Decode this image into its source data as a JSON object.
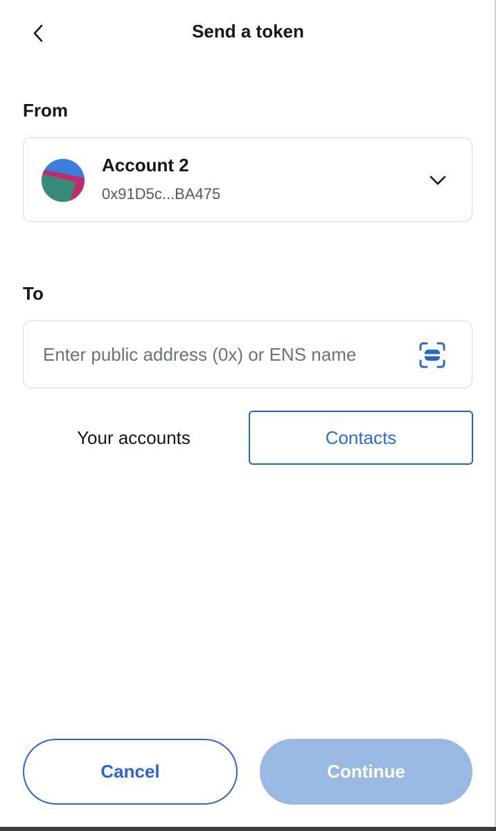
{
  "header": {
    "title": "Send a token",
    "back_icon": "chevron-left-icon"
  },
  "from": {
    "label": "From",
    "account_name": "Account 2",
    "account_address": "0x91D5c...BA475",
    "avatar_colors": [
      "#3b7ddd",
      "#c22b6b",
      "#3a8a79"
    ],
    "dropdown_icon": "chevron-down-icon"
  },
  "to": {
    "label": "To",
    "placeholder": "Enter public address (0x) or ENS name",
    "value": "",
    "scan_icon": "qr-scan-icon"
  },
  "tabs": [
    {
      "label": "Your accounts",
      "selected": false
    },
    {
      "label": "Contacts",
      "selected": true
    }
  ],
  "footer": {
    "cancel_label": "Cancel",
    "continue_label": "Continue",
    "continue_disabled": true
  },
  "colors": {
    "accent": "#2a67c6",
    "disabled_button": "#9ab9e2",
    "border": "#d6d9dc",
    "text_primary": "#141618",
    "text_secondary": "#535a61"
  }
}
